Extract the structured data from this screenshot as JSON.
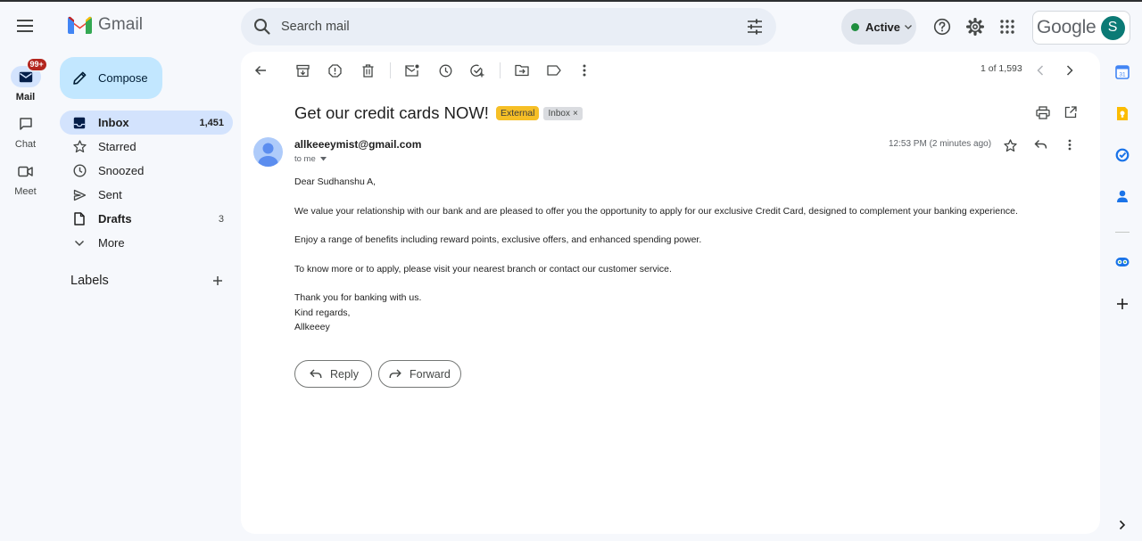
{
  "app": {
    "name": "Gmail"
  },
  "search": {
    "placeholder": "Search mail"
  },
  "status": {
    "label": "Active",
    "color": "#1e8e3e"
  },
  "account": {
    "brand": "Google",
    "initial": "S"
  },
  "rail": [
    {
      "label": "Mail",
      "badge": "99+",
      "active": true
    },
    {
      "label": "Chat"
    },
    {
      "label": "Meet"
    }
  ],
  "compose": {
    "label": "Compose"
  },
  "nav": [
    {
      "name": "Inbox",
      "count": "1,451",
      "icon": "inbox-icon",
      "active": true
    },
    {
      "name": "Starred",
      "count": "",
      "icon": "star-icon"
    },
    {
      "name": "Snoozed",
      "count": "",
      "icon": "clock-icon"
    },
    {
      "name": "Sent",
      "count": "",
      "icon": "send-icon"
    },
    {
      "name": "Drafts",
      "count": "3",
      "icon": "draft-icon"
    },
    {
      "name": "More",
      "count": "",
      "icon": "chevron-down-icon"
    }
  ],
  "labels": {
    "title": "Labels"
  },
  "toolbar": {
    "pager": "1 of 1,593"
  },
  "message": {
    "subject": "Get our credit cards NOW!",
    "chip_external": "External",
    "chip_inbox": "Inbox",
    "chip_inbox_close": "×",
    "sender": "allkeeeymist@gmail.com",
    "to": "to me",
    "time": "12:53 PM (2 minutes ago)",
    "body": [
      "Dear Sudhanshu A,",
      "We value your relationship with our bank and are pleased to offer you the opportunity to apply for our exclusive Credit Card, designed to complement your banking experience.",
      "Enjoy a range of benefits including reward points, exclusive offers, and enhanced spending power.",
      "To know more or to apply, please visit your nearest branch or contact our customer service."
    ],
    "closing": [
      "Thank you for banking with us.",
      "Kind regards,",
      "Allkeeey"
    ]
  },
  "actions": {
    "reply": "Reply",
    "forward": "Forward"
  },
  "colors": {
    "accent": "#0b57d0",
    "nav_active": "#d3e3fd",
    "compose": "#c2e7ff",
    "external_chip": "#f6bf26"
  }
}
